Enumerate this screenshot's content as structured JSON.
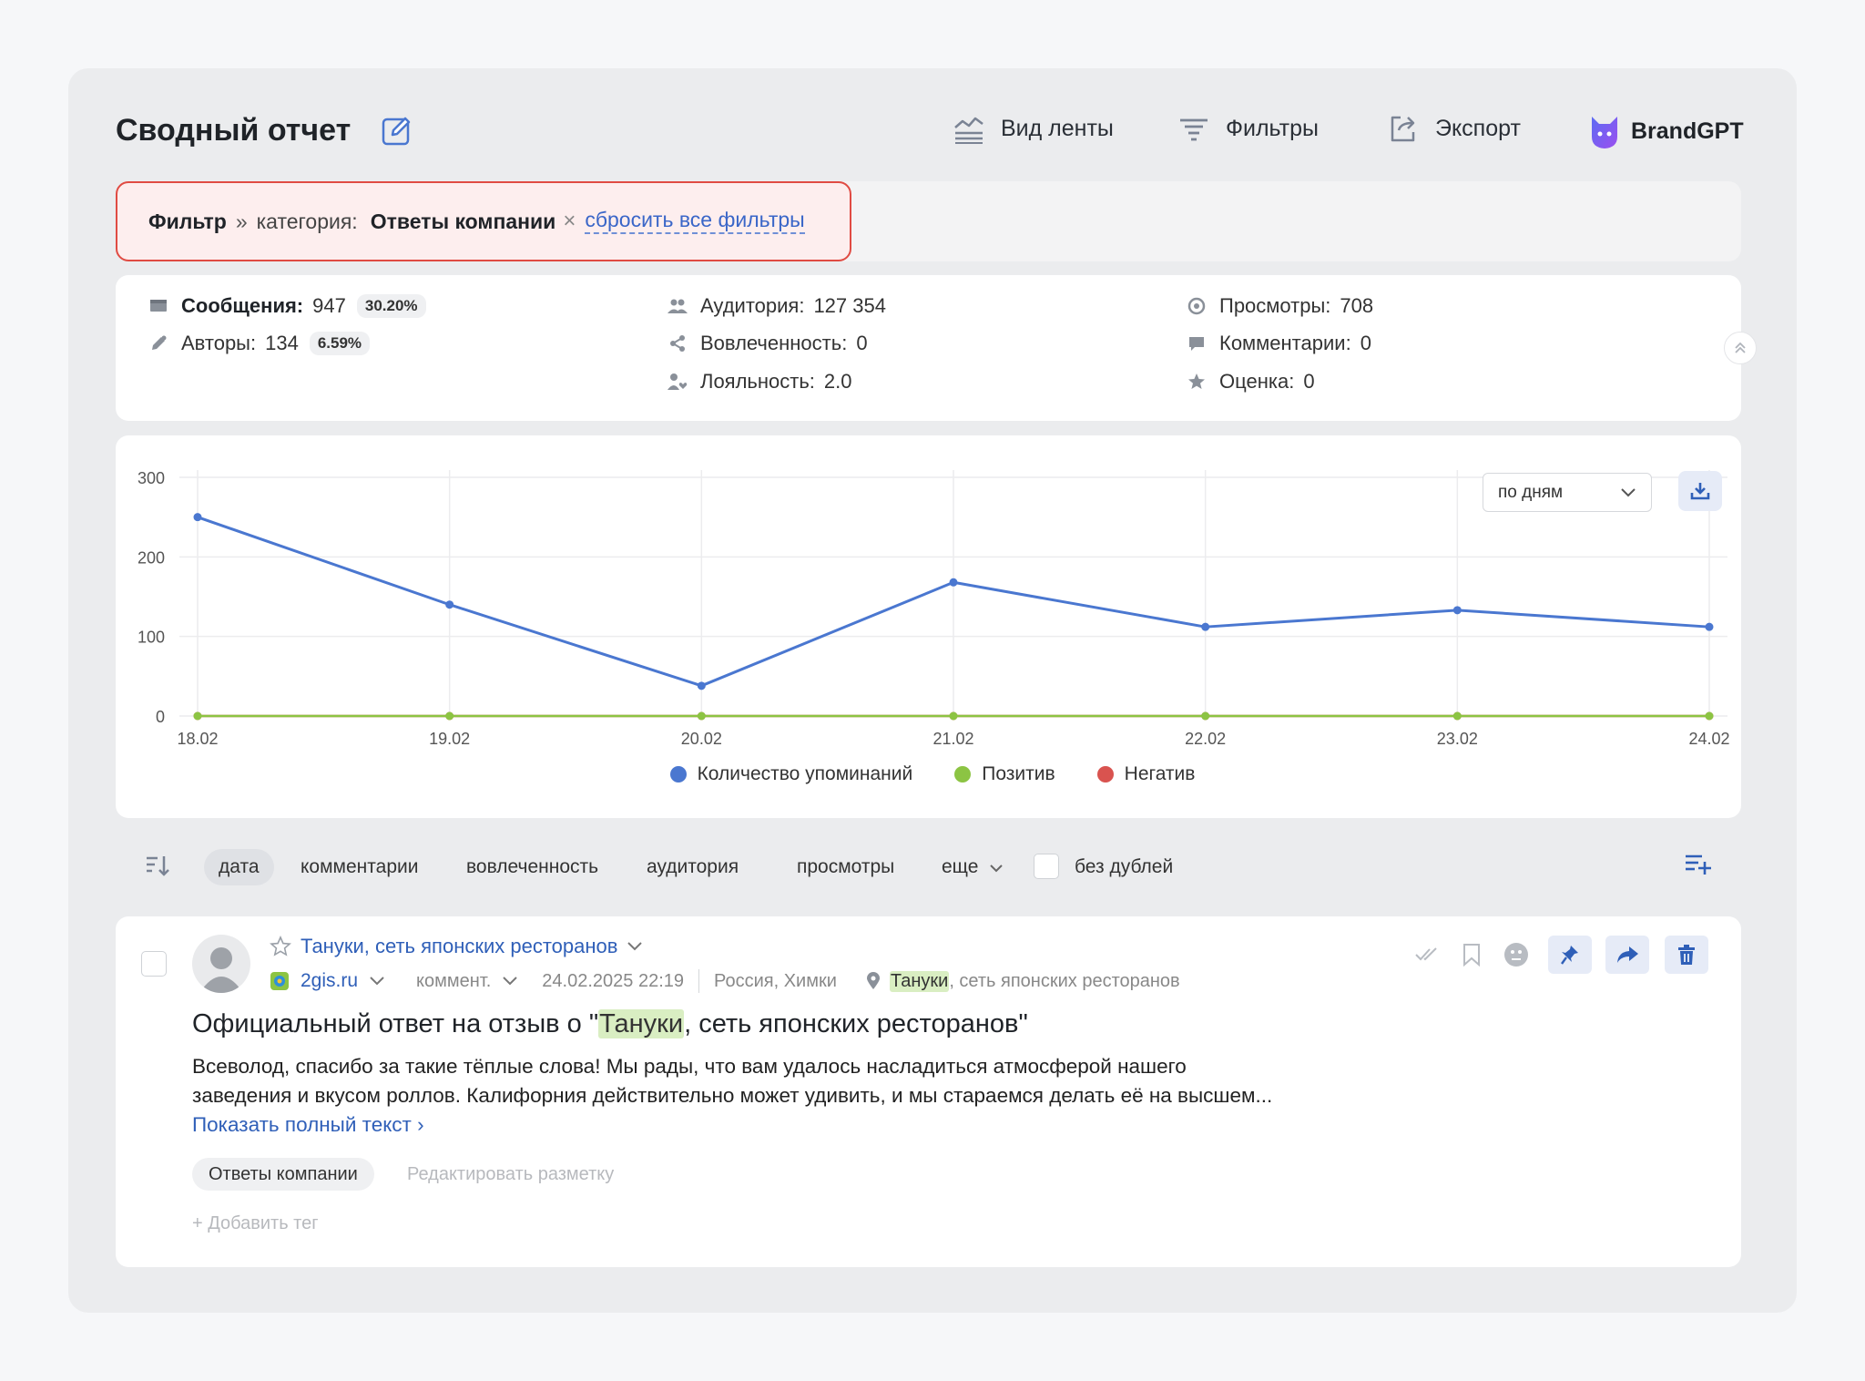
{
  "header": {
    "title": "Сводный отчет",
    "feed_view": "Вид ленты",
    "filters": "Фильтры",
    "export": "Экспорт",
    "brandgpt": "BrandGPT"
  },
  "filter": {
    "label": "Фильтр",
    "separator": "»",
    "category_label": "категория:",
    "category_value": "Ответы компании",
    "remove": "×",
    "reset": "сбросить все фильтры"
  },
  "stats": {
    "messages": {
      "label": "Сообщения:",
      "value": "947",
      "pct": "30.20%"
    },
    "authors": {
      "label": "Авторы:",
      "value": "134",
      "pct": "6.59%"
    },
    "audience": {
      "label": "Аудитория:",
      "value": "127 354"
    },
    "engagement": {
      "label": "Вовлеченность:",
      "value": "0"
    },
    "loyalty": {
      "label": "Лояльность:",
      "value": "2.0"
    },
    "views": {
      "label": "Просмотры:",
      "value": "708"
    },
    "comments": {
      "label": "Комментарии:",
      "value": "0"
    },
    "rating": {
      "label": "Оценка:",
      "value": "0"
    }
  },
  "chart_controls": {
    "period": "по дням"
  },
  "chart_data": {
    "type": "line",
    "categories": [
      "18.02",
      "19.02",
      "20.02",
      "21.02",
      "22.02",
      "23.02",
      "24.02"
    ],
    "ylim": [
      0,
      300
    ],
    "yticks": [
      0,
      100,
      200,
      300
    ],
    "grid": true,
    "legend": "bottom",
    "series": [
      {
        "name": "Количество упоминаний",
        "color": "#4a77d0",
        "values": [
          250,
          140,
          38,
          168,
          112,
          133,
          112
        ]
      },
      {
        "name": "Позитив",
        "color": "#8cc443",
        "values": [
          0,
          0,
          0,
          0,
          0,
          0,
          0
        ]
      },
      {
        "name": "Негатив",
        "color": "#d9534f",
        "values": [
          0,
          0,
          0,
          0,
          0,
          0,
          0
        ]
      }
    ]
  },
  "sort": {
    "options": [
      "дата",
      "комментарии",
      "вовлеченность",
      "аудитория",
      "просмотры",
      "еще"
    ],
    "no_duplicates": "без дублей"
  },
  "message": {
    "author": "Тануки, сеть японских ресторанов",
    "source": "2gis.ru",
    "type": "коммент.",
    "datetime": "24.02.2025 22:19",
    "location": "Россия, Химки",
    "place_highlight": "Тануки",
    "place_rest": ", сеть японских ресторанов",
    "title_pre": "Официальный ответ на отзыв о \"",
    "title_highlight": "Тануки",
    "title_post": ", сеть японских ресторанов\"",
    "body": "Всеволод, спасибо за такие тёплые слова! Мы рады, что вам удалось насладиться атмосферой нашего заведения и вкусом роллов. Калифорния действительно может удивить, и мы стараемся делать её на высшем...",
    "show_more": "Показать полный текст ›",
    "tag": "Ответы компании",
    "edit_markup": "Редактировать разметку",
    "add_tag": "+  Добавить тег"
  },
  "colors": {
    "accent": "#2f5fb8",
    "filter_border": "#e04b43",
    "highlight": "#d9eec2"
  }
}
